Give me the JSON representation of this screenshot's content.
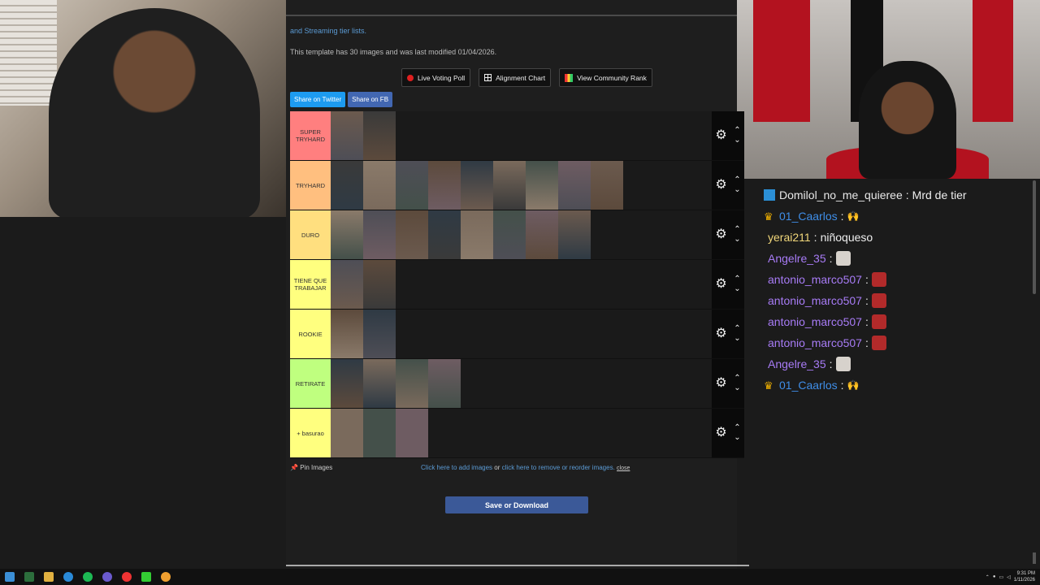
{
  "browser": {
    "cut_text": "and Streaming tier lists.",
    "info": "This template has 30 images and was last modified 01/04/2026.",
    "buttons": {
      "voting": "Live Voting Poll",
      "alignment": "Alignment Chart",
      "community": "View Community Rank"
    },
    "share": {
      "twitter": "Share on Twitter",
      "facebook": "Share on FB"
    },
    "tiers": [
      {
        "label": "SUPER TRYHARD",
        "color": "#ff7f7f",
        "count": 2
      },
      {
        "label": "TRYHARD",
        "color": "#ffbf7f",
        "count": 9
      },
      {
        "label": "DURO",
        "color": "#ffdf7f",
        "count": 8
      },
      {
        "label": "TIENE QUE TRABAJAR",
        "color": "#ffff7f",
        "count": 2
      },
      {
        "label": "ROOKIE",
        "color": "#ffff7f",
        "count": 2
      },
      {
        "label": "RETIRATE",
        "color": "#bfff7f",
        "count": 4
      },
      {
        "label": "+ basurao",
        "color": "#ffff7f",
        "count": 3
      }
    ],
    "pin": "Pin Images",
    "links": {
      "add": "Click here to add images",
      "or": "or",
      "remove": "click here to remove or reorder images.",
      "close": "close"
    },
    "save": "Save or Download"
  },
  "chat": [
    {
      "badge": "prime",
      "user": "Domilol_no_me_quieree",
      "user_color": "#e8e8e8",
      "message": "Mrd de tier",
      "emote": ""
    },
    {
      "badge": "crown",
      "user": "01_Caarlos",
      "user_color": "#3f8ee8",
      "message": "",
      "emote": "hands"
    },
    {
      "badge": "",
      "user": "yerai211",
      "user_color": "#f0d67a",
      "message": "niñoqueso",
      "emote": ""
    },
    {
      "badge": "",
      "user": "Angelre_35",
      "user_color": "#a77bf5",
      "message": "",
      "emote": "face"
    },
    {
      "badge": "",
      "user": "antonio_marco507",
      "user_color": "#a77bf5",
      "message": "",
      "emote": "red"
    },
    {
      "badge": "",
      "user": "antonio_marco507",
      "user_color": "#a77bf5",
      "message": "",
      "emote": "red"
    },
    {
      "badge": "",
      "user": "antonio_marco507",
      "user_color": "#a77bf5",
      "message": "",
      "emote": "red"
    },
    {
      "badge": "",
      "user": "antonio_marco507",
      "user_color": "#a77bf5",
      "message": "",
      "emote": "red"
    },
    {
      "badge": "",
      "user": "Angelre_35",
      "user_color": "#a77bf5",
      "message": "",
      "emote": "face"
    },
    {
      "badge": "crown",
      "user": "01_Caarlos",
      "user_color": "#3f8ee8",
      "message": "",
      "emote": "hands"
    }
  ],
  "taskbar": {
    "time": "9:31 PM",
    "date": "1/11/2026"
  }
}
